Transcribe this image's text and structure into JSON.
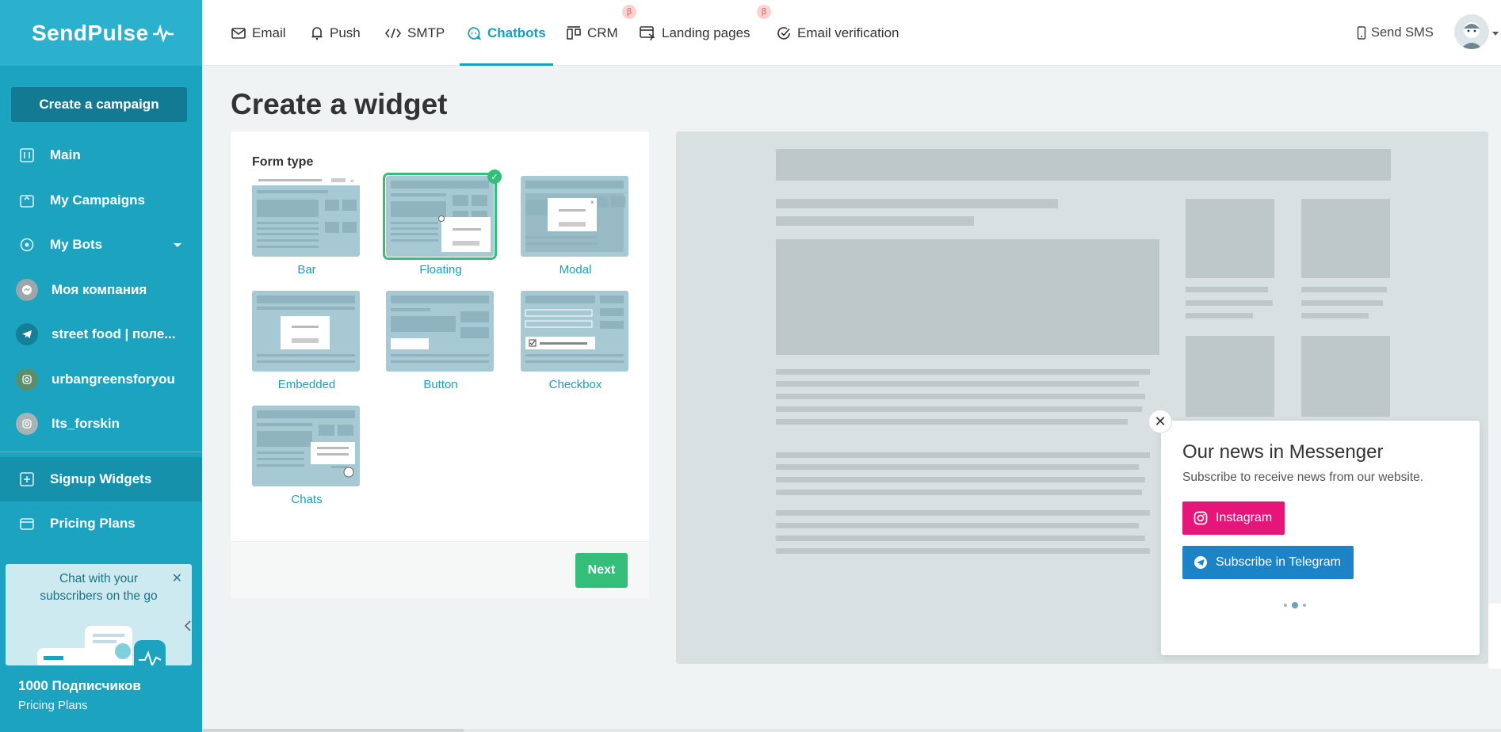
{
  "sidebar": {
    "logo": "SendPulse",
    "create_campaign": "Create a campaign",
    "items": [
      {
        "label": "Main",
        "icon": "dashboard-icon"
      },
      {
        "label": "My Campaigns",
        "icon": "campaigns-icon"
      },
      {
        "label": "My Bots",
        "icon": "bots-icon"
      },
      {
        "label": "Моя компания",
        "icon": "messenger-icon"
      },
      {
        "label": "street food | поле...",
        "icon": "telegram-icon"
      },
      {
        "label": "urbangreensforyou",
        "icon": "instagram-icon"
      },
      {
        "label": "Its_forskin",
        "icon": "instagram-icon"
      },
      {
        "label": "Signup Widgets",
        "icon": "widgets-icon"
      },
      {
        "label": "Pricing Plans",
        "icon": "wallet-icon"
      }
    ],
    "promo": {
      "text_line1": "Chat with your",
      "text_line2": "subscribers on the go"
    },
    "plan": {
      "title": "1000 Подписчиков",
      "sub": "Pricing Plans"
    }
  },
  "topbar": {
    "tabs": [
      {
        "label": "Email",
        "icon": "envelope-icon"
      },
      {
        "label": "Push",
        "icon": "bell-icon"
      },
      {
        "label": "SMTP",
        "icon": "code-icon"
      },
      {
        "label": "Chatbots",
        "icon": "chatbot-icon",
        "active": true
      },
      {
        "label": "CRM",
        "icon": "crm-icon",
        "beta": "β"
      },
      {
        "label": "Landing pages",
        "icon": "landing-icon",
        "beta": "β"
      },
      {
        "label": "Email verification",
        "icon": "check-circle-icon"
      }
    ],
    "send_sms": "Send SMS"
  },
  "main": {
    "title": "Create a widget",
    "form_type_label": "Form type",
    "options": [
      {
        "label": "Bar"
      },
      {
        "label": "Floating",
        "selected": true
      },
      {
        "label": "Modal"
      },
      {
        "label": "Embedded"
      },
      {
        "label": "Button"
      },
      {
        "label": "Checkbox"
      },
      {
        "label": "Chats"
      }
    ],
    "next": "Next"
  },
  "preview": {
    "widget": {
      "title": "Our news in Messenger",
      "subtitle": "Subscribe to receive news from our website.",
      "instagram_btn": "Instagram",
      "telegram_btn": "Subscribe in Telegram",
      "close": "✕"
    }
  },
  "colors": {
    "sidebar": "#1ba3c0",
    "accent": "#1a9fbb",
    "green": "#34be7a",
    "instagram": "#e5157a",
    "telegram": "#1b83c6"
  }
}
